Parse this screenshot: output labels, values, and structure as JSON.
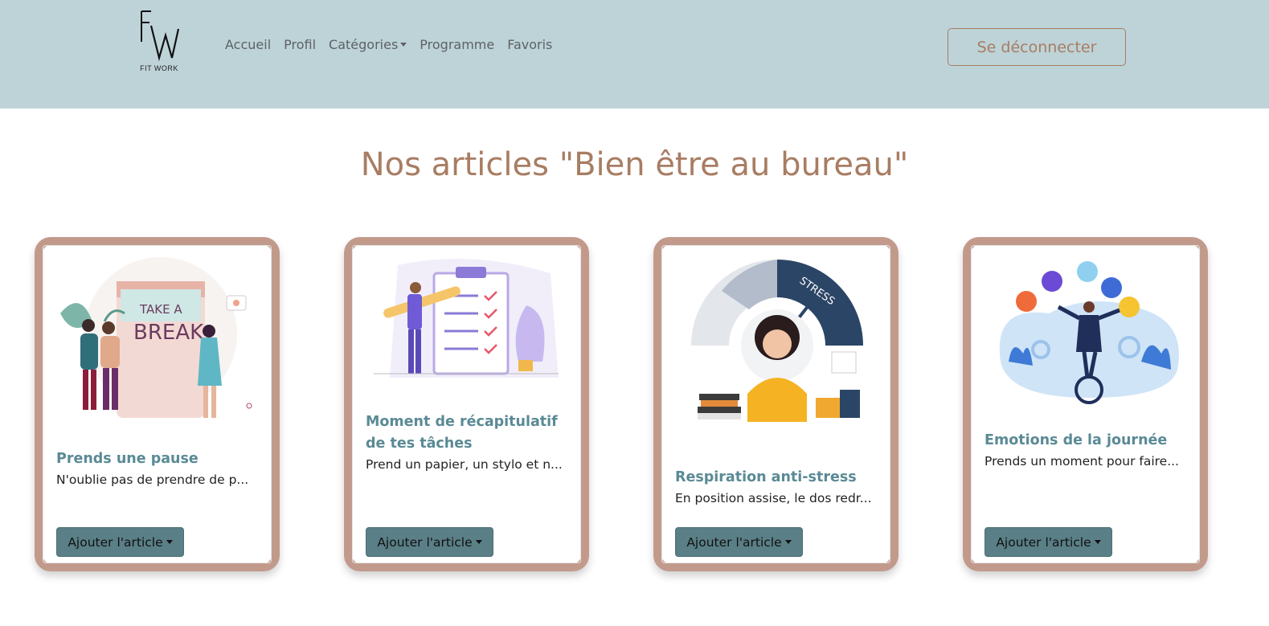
{
  "brand": {
    "logo_letters": "FW",
    "logo_text": "FIT WORK"
  },
  "nav": {
    "items": [
      {
        "label": "Accueil"
      },
      {
        "label": "Profil"
      },
      {
        "label": "Catégories",
        "dropdown": true
      },
      {
        "label": "Programme"
      },
      {
        "label": "Favoris"
      }
    ],
    "logout_label": "Se déconnecter"
  },
  "colors": {
    "navbar_bg": "#bdd3d8",
    "accent_brown": "#a87d63",
    "card_border": "#c29a8c",
    "card_title": "#5a8a95",
    "button_bg": "#5a7f86"
  },
  "page": {
    "title": "Nos articles \"Bien être au bureau\""
  },
  "cards": [
    {
      "title": "Prends une pause",
      "text": "N'oublie pas de prendre de p...",
      "button": "Ajouter l'article",
      "illustration": "take-a-break-illustration",
      "image_text_1": "TAKE A",
      "image_text_2": "BREAK"
    },
    {
      "title": "Moment de récapitulatif de tes tâches",
      "text": "Prend un papier, un stylo et n...",
      "button": "Ajouter l'article",
      "illustration": "task-checklist-illustration"
    },
    {
      "title": "Respiration anti-stress",
      "text": "En position assise, le dos redr...",
      "button": "Ajouter l'article",
      "illustration": "stress-gauge-illustration",
      "image_text_1": "STRESS"
    },
    {
      "title": "Emotions de la journée",
      "text": "Prends un moment pour faire...",
      "button": "Ajouter l'article",
      "illustration": "juggling-emotions-illustration"
    }
  ]
}
